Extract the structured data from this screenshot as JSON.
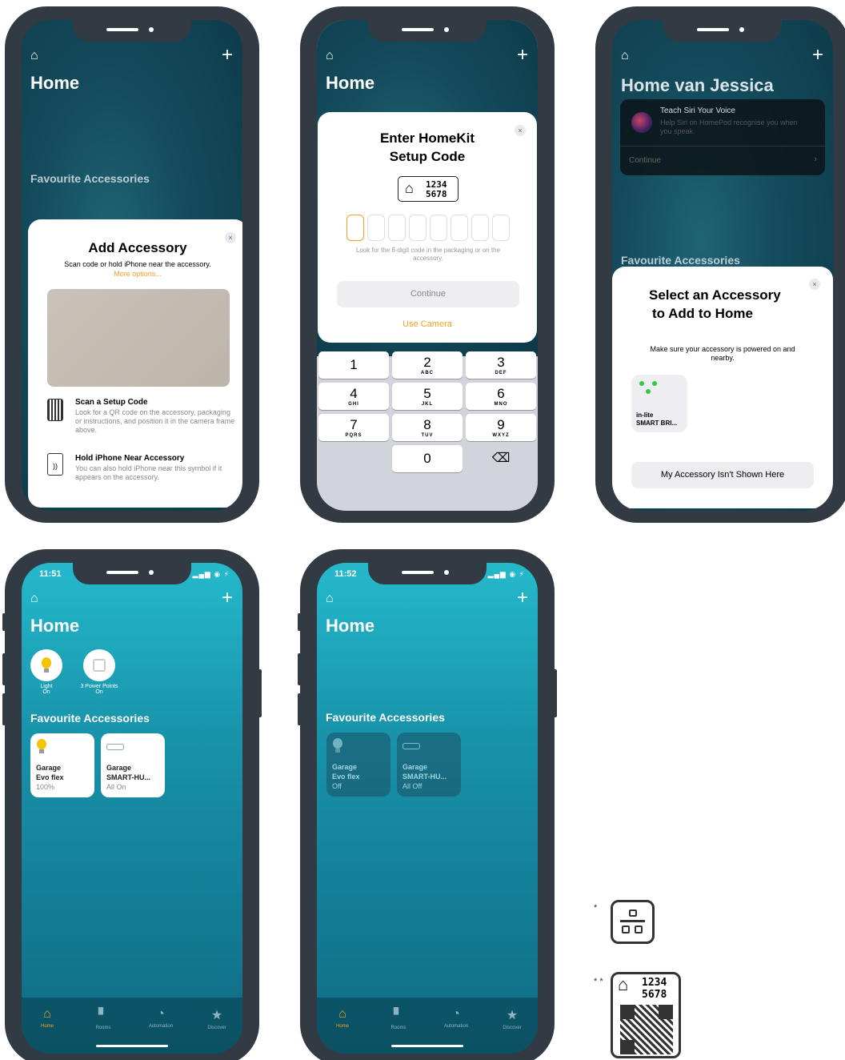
{
  "phone1": {
    "home_title": "Home",
    "favourites_heading": "Favourite Accessories",
    "sheet": {
      "title": "Add Accessory",
      "subtitle": "Scan code or hold iPhone near the accessory.",
      "more_options": "More options...",
      "scan_title": "Scan a Setup Code",
      "scan_desc": "Look for a QR code on the accessory, packaging or instructions, and position it in the camera frame above.",
      "hold_title": "Hold iPhone Near Accessory",
      "hold_desc": "You can also hold iPhone near this symbol if it appears on the accessory.",
      "close": "×"
    }
  },
  "phone2": {
    "home_title": "Home",
    "sheet": {
      "title_line1": "Enter HomeKit",
      "title_line2": "Setup Code",
      "code_line1": "1234",
      "code_line2": "5678",
      "hint": "Look for the 8-digit code in the packaging or on the accessory.",
      "continue": "Continue",
      "use_camera": "Use Camera",
      "close": "×"
    },
    "keypad": [
      {
        "n": "1",
        "l": ""
      },
      {
        "n": "2",
        "l": "ABC"
      },
      {
        "n": "3",
        "l": "DEF"
      },
      {
        "n": "4",
        "l": "GHI"
      },
      {
        "n": "5",
        "l": "JKL"
      },
      {
        "n": "6",
        "l": "MNO"
      },
      {
        "n": "7",
        "l": "PQRS"
      },
      {
        "n": "8",
        "l": "TUV"
      },
      {
        "n": "9",
        "l": "WXYZ"
      },
      {
        "n": "0",
        "l": ""
      }
    ],
    "delete_key": "⌫"
  },
  "phone3": {
    "home_title": "Home van Jessica",
    "siri": {
      "title": "Teach Siri Your Voice",
      "desc": "Help Siri on HomePod recognise you when you speak.",
      "continue": "Continue"
    },
    "favourites_heading": "Favourite Accessories",
    "sheet": {
      "title_line1": "Select an Accessory",
      "title_line2": "to Add to Home",
      "desc": "Make sure your accessory is powered on and nearby.",
      "tile_line1": "in-lite",
      "tile_line2": "SMART BRI...",
      "not_shown": "My Accessory Isn't Shown Here",
      "close": "×"
    }
  },
  "phone4": {
    "time": "11:51",
    "home_title": "Home",
    "status_light": "Light",
    "status_light_state": "On",
    "status_power": "3 Power Points",
    "status_power_state": "On",
    "favourites_heading": "Favourite Accessories",
    "tile1": {
      "room": "Garage",
      "name": "Evo flex",
      "state": "100%"
    },
    "tile2": {
      "room": "Garage",
      "name": "SMART-HU...",
      "state": "All On"
    }
  },
  "phone5": {
    "time": "11:52",
    "home_title": "Home",
    "favourites_heading": "Favourite Accessories",
    "tile1": {
      "room": "Garage",
      "name": "Evo flex",
      "state": "Off"
    },
    "tile2": {
      "room": "Garage",
      "name": "SMART-HU...",
      "state": "All Off"
    }
  },
  "tabs": [
    "Home",
    "Rooms",
    "Automation",
    "Discover"
  ],
  "footnotes": {
    "star1": "*",
    "star2": "* *",
    "code_line1": "1234",
    "code_line2": "5678"
  },
  "colors": {
    "accent": "#f4a020",
    "phone_frame": "#323a44",
    "bulb": "#f5c400"
  }
}
